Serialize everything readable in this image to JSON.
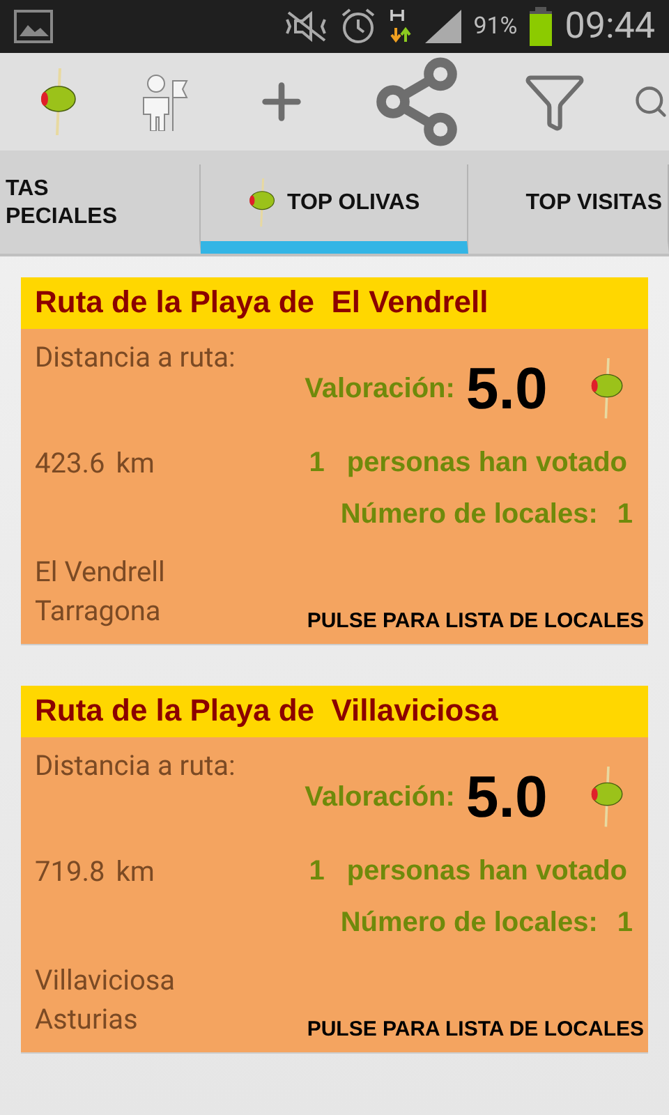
{
  "status_bar": {
    "battery_text": "91%",
    "time": "09:44"
  },
  "tabs": [
    {
      "label": "TAS\nPECIALES",
      "selected": false,
      "has_icon": false
    },
    {
      "label": "TOP OLIVAS",
      "selected": true,
      "has_icon": true
    },
    {
      "label": "TOP VISITAS",
      "selected": false,
      "has_icon": false
    }
  ],
  "routes": [
    {
      "title": "Ruta de la Playa de  El Vendrell",
      "distance_label": "Distancia a ruta:",
      "distance": "423.6",
      "unit": "km",
      "rating_label": "Valoración:",
      "rating": "5.0",
      "votes": "1",
      "votes_label": "personas han votado",
      "locales_label": "Número de locales:",
      "locales": "1",
      "city": "El Vendrell",
      "province": "Tarragona",
      "action": "PULSE PARA LISTA DE LOCALES"
    },
    {
      "title": "Ruta de la Playa de  Villaviciosa",
      "distance_label": "Distancia a ruta:",
      "distance": "719.8",
      "unit": "km",
      "rating_label": "Valoración:",
      "rating": "5.0",
      "votes": "1",
      "votes_label": "personas han votado",
      "locales_label": "Número de locales:",
      "locales": "1",
      "city": "Villaviciosa",
      "province": "Asturias",
      "action": "PULSE PARA LISTA DE LOCALES"
    }
  ]
}
